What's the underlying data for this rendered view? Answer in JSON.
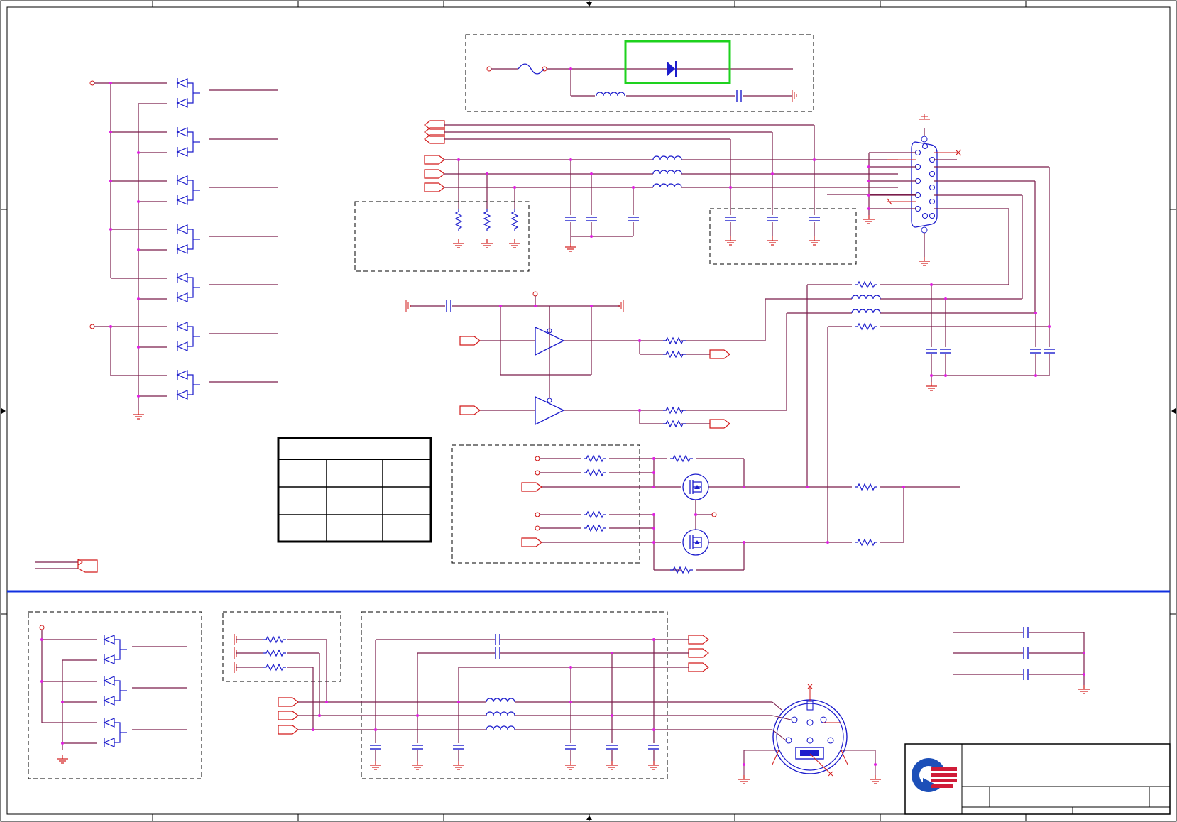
{
  "sheet": {
    "title": "",
    "colors": {
      "wire": "#7a1c4a",
      "pin": "#d21a1a",
      "part": "#1c1ccc",
      "junction": "#e020e0",
      "frame": "#000000",
      "highlight": "#1ed21e",
      "divider": "#1030e0",
      "logo_red": "#d01c38",
      "logo_blue": "#1c4fb8"
    },
    "regions": [
      "diode-array-block",
      "fuse-diode-block",
      "vga-connector-block",
      "buffer-block",
      "level-shift-block",
      "info-table",
      "ps2-diode-block",
      "ps2-resistor-block",
      "ps2-filter-block",
      "mini-din-connector",
      "bypass-caps",
      "title-block"
    ]
  }
}
